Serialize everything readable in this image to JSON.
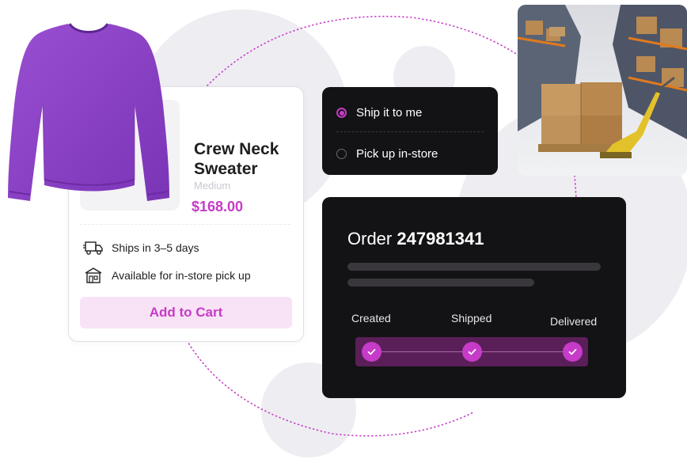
{
  "product": {
    "title": "Crew Neck Sweater",
    "variant": "Medium",
    "price": "$168.00",
    "features": [
      {
        "icon": "delivery-truck-icon",
        "text": "Ships in 3–5 days"
      },
      {
        "icon": "store-icon",
        "text": "Available for in-store pick up"
      }
    ],
    "add_to_cart_label": "Add to Cart"
  },
  "delivery_options": [
    {
      "label": "Ship it to me",
      "selected": true
    },
    {
      "label": "Pick up in-store",
      "selected": false
    }
  ],
  "order": {
    "prefix": "Order",
    "number": "247981341",
    "steps": [
      "Created",
      "Shipped",
      "Delivered"
    ],
    "progress": 1.0
  },
  "colors": {
    "accent": "#c63bc7",
    "button_bg": "#f8e3f6",
    "dark_card": "#131214",
    "sweater": "#8a3fc4"
  }
}
